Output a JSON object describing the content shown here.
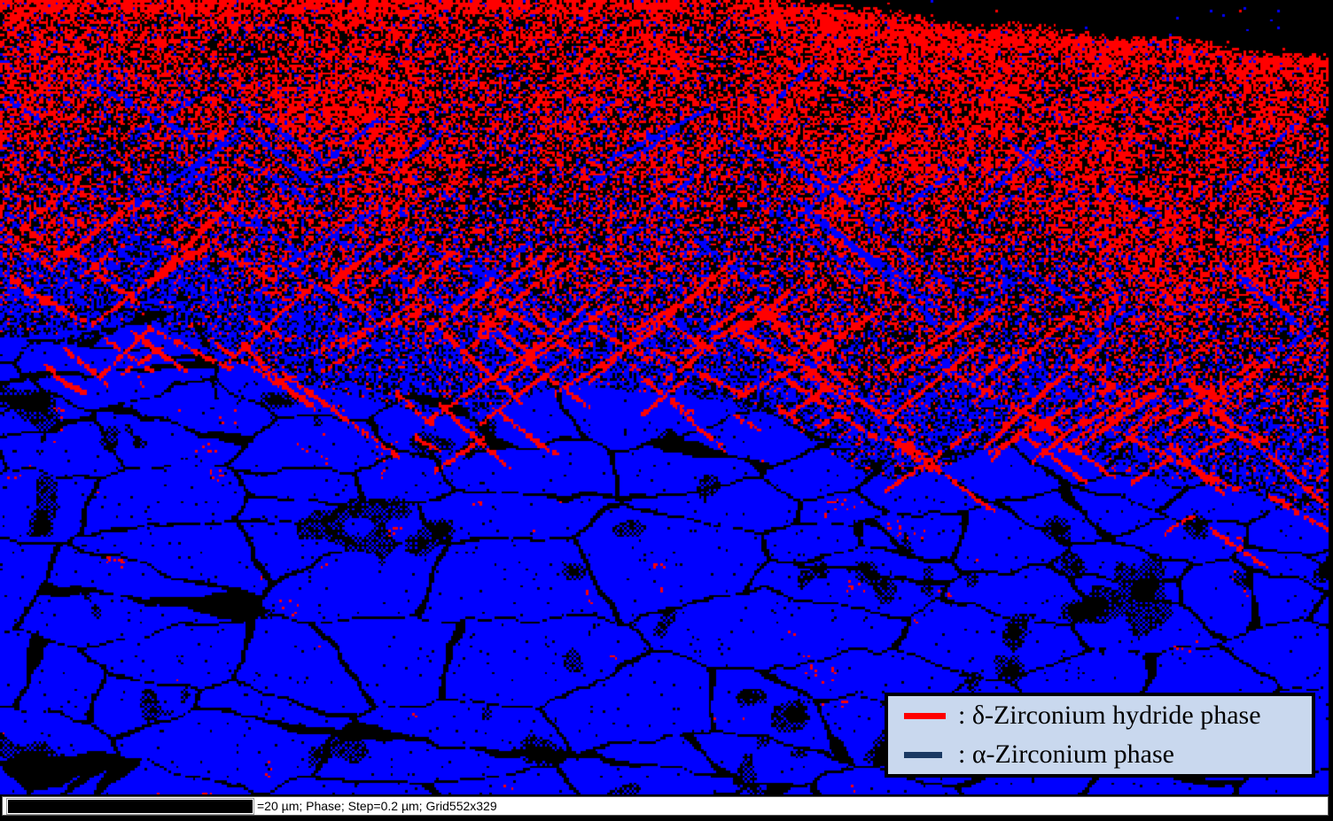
{
  "legend": {
    "background": "#c9d8ee",
    "border_color": "#000000",
    "items": [
      {
        "name": "delta-zirconium-hydride",
        "swatch_color": "#ff0000",
        "label": ": δ-Zirconium hydride phase"
      },
      {
        "name": "alpha-zirconium",
        "swatch_color": "#1b3a63",
        "label": ": α-Zirconium phase"
      }
    ]
  },
  "status_bar": {
    "scale_text": "=20 µm; Phase; Step=0.2 µm; Grid552x329",
    "background": "#ffffff",
    "bar_color": "#000000"
  },
  "map": {
    "grid_cols": 552,
    "grid_rows": 329,
    "step_um": "0.2",
    "scale_um": "20",
    "colors": {
      "hydride_phase": "#ff0000",
      "alpha_phase": "#0000ff",
      "unindexed": "#000000"
    }
  }
}
